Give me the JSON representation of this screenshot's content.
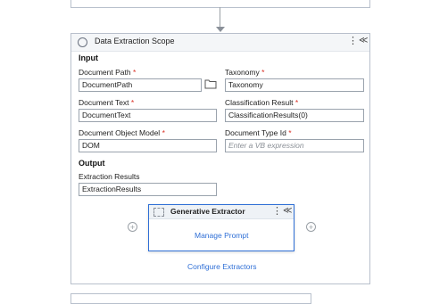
{
  "scope": {
    "title": "Data Extraction Scope",
    "kebab": "⋮",
    "collapse": "≪"
  },
  "input_section": "Input",
  "output_section": "Output",
  "fields": {
    "document_path": {
      "label": "Document Path",
      "value": "DocumentPath"
    },
    "taxonomy": {
      "label": "Taxonomy",
      "value": "Taxonomy"
    },
    "document_text": {
      "label": "Document Text",
      "value": "DocumentText"
    },
    "classification_result": {
      "label": "Classification Result",
      "value": "ClassificationResults(0)"
    },
    "document_object_model": {
      "label": "Document Object Model",
      "value": "DOM"
    },
    "document_type_id": {
      "label": "Document Type Id",
      "placeholder": "Enter a VB expression"
    },
    "extraction_results": {
      "label": "Extraction Results",
      "value": "ExtractionResults"
    }
  },
  "required_marker": "*",
  "extractor": {
    "title": "Generative Extractor",
    "kebab": "⋮",
    "collapse": "≪",
    "manage_prompt": "Manage Prompt"
  },
  "configure_extractors": "Configure Extractors",
  "add_symbol": "+"
}
